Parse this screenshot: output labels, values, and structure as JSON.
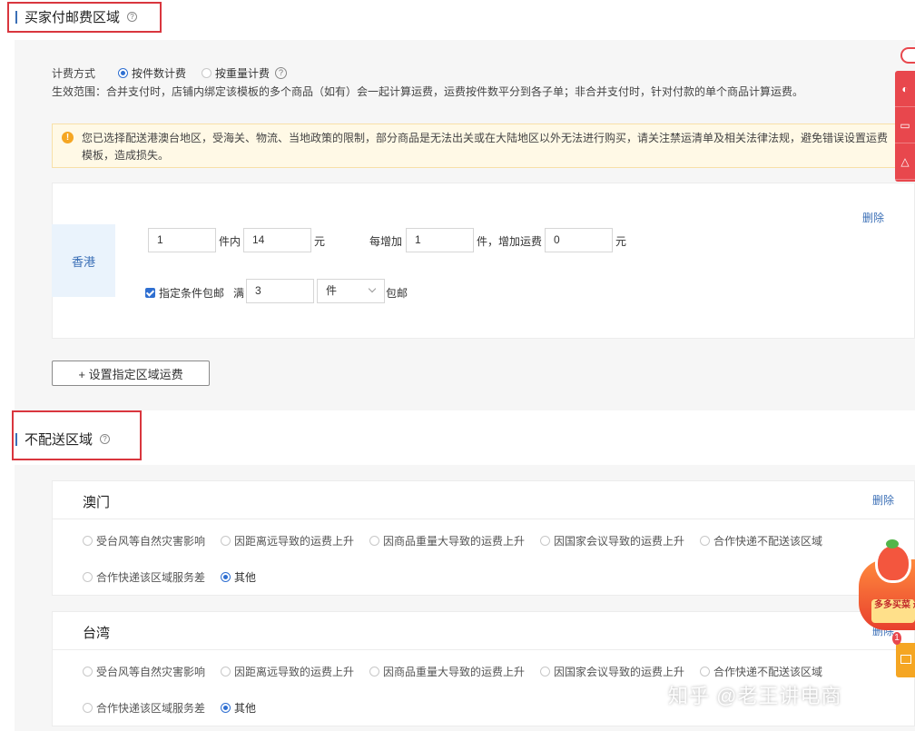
{
  "buyer_section": {
    "title": "买家付邮费区域",
    "billing_label": "计费方式",
    "options": [
      {
        "label": "按件数计费",
        "selected": true
      },
      {
        "label": "按重量计费",
        "selected": false
      }
    ],
    "scope_text": "生效范围：合并支付时，店铺内绑定该模板的多个商品（如有）会一起计算运费，运费按件数平分到各子单；非合并支付时，针对付款的单个商品计算运费。",
    "warning_icon": "!",
    "warning_text": "您已选择配送港澳台地区，受海关、物流、当地政策的限制，部分商品是无法出关或在大陆地区以外无法进行购买，请关注禁运清单及相关法律法规，避免错误设置运费模板，造成损失。",
    "region": {
      "name": "香港",
      "delete_label": "删除",
      "first_qty": "1",
      "first_qty_unit": "件内",
      "first_fee": "14",
      "first_fee_unit": "元",
      "add_label": "每增加",
      "add_qty": "1",
      "add_fee_label": "件，增加运费",
      "add_fee": "0",
      "add_fee_unit": "元",
      "free_checkbox_label": "指定条件包邮",
      "free_checked": true,
      "free_prefix": "满",
      "free_qty": "3",
      "free_unit_select": "件",
      "free_suffix": "包邮"
    },
    "add_region_button": "+ 设置指定区域运费"
  },
  "no_delivery_section": {
    "title": "不配送区域",
    "regions": [
      {
        "name": "澳门",
        "delete_label": "删除",
        "reasons": [
          "受台风等自然灾害影响",
          "因距离远导致的运费上升",
          "因商品重量大导致的运费上升",
          "因国家会议导致的运费上升",
          "合作快递不配送该区域",
          "合作快递该区域服务差",
          "其他"
        ],
        "selected_index": 6
      },
      {
        "name": "台湾",
        "delete_label": "删除",
        "reasons": [
          "受台风等自然灾害影响",
          "因距离远导致的运费上升",
          "因商品重量大导致的运费上升",
          "因国家会议导致的运费上升",
          "合作快递不配送该区域",
          "合作快递该区域服务差",
          "其他"
        ],
        "selected_index": 6
      }
    ]
  },
  "promo": {
    "label": "多多买菜 邀您入驻"
  },
  "message_badge": "1",
  "watermark": "知乎 @老王讲电商",
  "colors": {
    "accent": "#2f6fd1",
    "link": "#3b6fb6",
    "highlight": "#d9363e",
    "warning": "#f5a623"
  }
}
